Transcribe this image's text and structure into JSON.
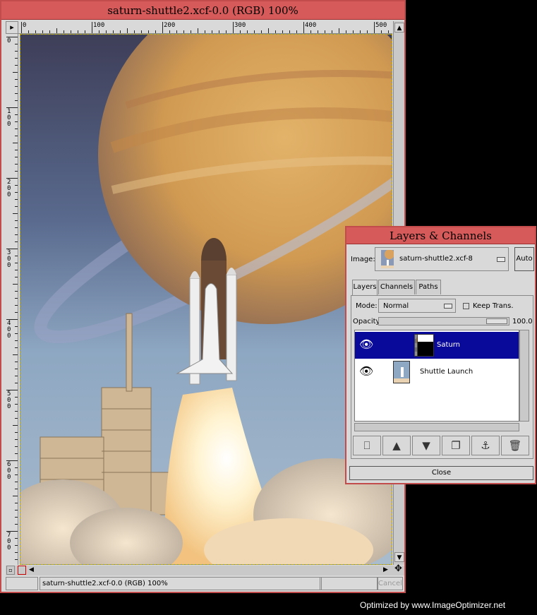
{
  "main_window": {
    "title": "saturn-shuttle2.xcf-0.0 (RGB) 100%",
    "status_text": "saturn-shuttle2.xcf-0.0 (RGB) 100%",
    "cancel_label": "Cancel",
    "hruler_labels": [
      "0",
      "100",
      "200",
      "300",
      "400",
      "500"
    ],
    "vruler_labels": [
      "0",
      "100",
      "200",
      "300",
      "400",
      "500",
      "600",
      "700"
    ]
  },
  "layers_dialog": {
    "title": "Layers & Channels",
    "image_label": "Image:",
    "image_value": "saturn-shuttle2.xcf-8",
    "auto_label": "Auto",
    "tabs": [
      {
        "label": "Layers",
        "active": true
      },
      {
        "label": "Channels",
        "active": false
      },
      {
        "label": "Paths",
        "active": false
      }
    ],
    "mode_label": "Mode:",
    "mode_value": "Normal",
    "keep_trans_label": "Keep Trans.",
    "opacity_label": "Opacity:",
    "opacity_value": "100.0",
    "layers": [
      {
        "name": "Saturn",
        "selected": true,
        "visible": true
      },
      {
        "name": "Shuttle Launch",
        "selected": false,
        "visible": true
      }
    ],
    "buttons": [
      "new-layer",
      "raise-layer",
      "lower-layer",
      "duplicate-layer",
      "anchor-layer",
      "delete-layer"
    ],
    "close_label": "Close"
  },
  "footer": {
    "optimized_text": "Optimized by www.ImageOptimizer.net"
  },
  "colors": {
    "title_bar": "#d65a5a",
    "window_border": "#c24c4c",
    "selection": "#0a0a9a",
    "window_bg": "#d9d9d9"
  }
}
